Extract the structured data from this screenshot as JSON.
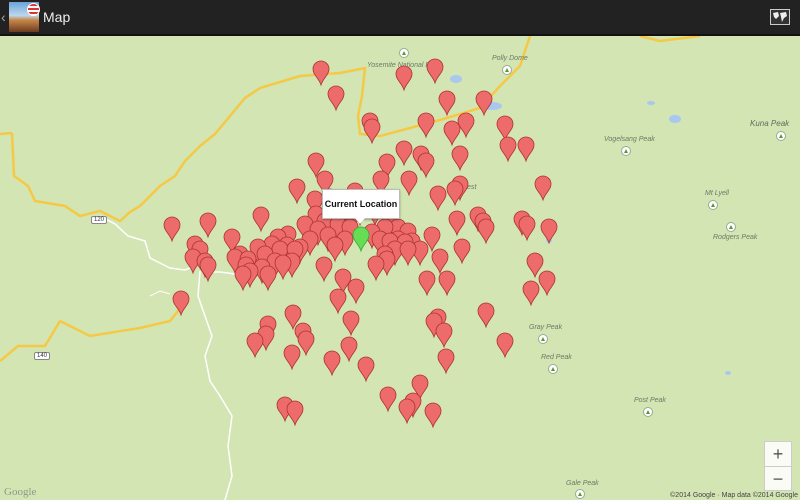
{
  "actionbar": {
    "title": "Map",
    "back_icon": "chevron-left-icon",
    "map_type_icon": "world-map-icon"
  },
  "popup": {
    "label": "Current Location"
  },
  "map_labels": {
    "yosemite": "Yosemite National Park",
    "polly_dome": "Polly Dome",
    "vogelsang": "Vogelsang Peak",
    "kuna": "Kuna Peak",
    "lyell": "Mt Lyell",
    "rodgers": "Rodgers Peak",
    "gray": "Gray Peak",
    "red": "Red Peak",
    "post": "Post Peak",
    "gale": "Gale Peak",
    "rest": "Rest"
  },
  "shields": {
    "r120": "120",
    "r140": "140"
  },
  "zoom": {
    "in": "+",
    "out": "−"
  },
  "copyright": "©2014 Google · Map data ©2014 Google",
  "logo": "Google",
  "colors": {
    "marker": "#ee6b6b",
    "current": "#66dd55",
    "highway": "#f5c945",
    "land": "#d3e5b3"
  }
}
